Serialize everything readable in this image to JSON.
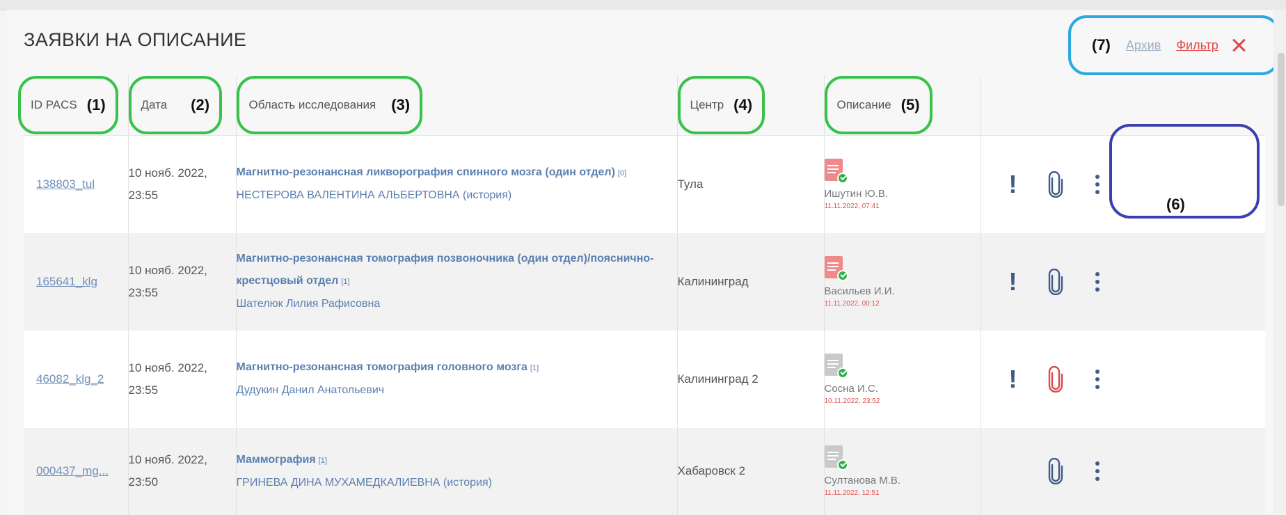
{
  "title": "ЗАЯВКИ НА ОПИСАНИЕ",
  "top_actions": {
    "annotation": "(7)",
    "archive_label": "Архив",
    "filter_label": "Фильтр",
    "close_icon": "close-icon"
  },
  "columns": [
    {
      "label": "ID PACS",
      "annotation": "(1)"
    },
    {
      "label": "Дата",
      "annotation": "(2)"
    },
    {
      "label": "Область исследования",
      "annotation": "(3)"
    },
    {
      "label": "Центр",
      "annotation": "(4)"
    },
    {
      "label": "Описание",
      "annotation": "(5)"
    },
    {
      "label": "",
      "annotation": ""
    }
  ],
  "actions_annotation": "(6)",
  "rows": [
    {
      "id": "138803_tul",
      "date_line1": "10 нояб. 2022,",
      "date_line2": "23:55",
      "study": "Магнитно-резонансная ликворография спинного мозга (один отдел)",
      "study_count": "[0]",
      "study_line2": "",
      "patient": "НЕСТЕРОВА ВАЛЕНТИНА АЛЬБЕРТОВНА (история)",
      "center": "Тула",
      "doc_icon": "red",
      "author": "Ишутин Ю.В.",
      "time": "11.11.2022, 07:41",
      "show_excl": true,
      "clip_color": "#3f5b86"
    },
    {
      "id": "165641_klg",
      "date_line1": "10 нояб. 2022,",
      "date_line2": "23:55",
      "study": "Магнитно-резонансная томография позвоночника (один отдел)/пояснично-",
      "study_count": "[1]",
      "study_line2": "крестцовый отдел",
      "patient": "Шателюк Лилия Рафисовна",
      "center": "Калининград",
      "doc_icon": "red",
      "author": "Васильев И.И.",
      "time": "11.11.2022, 00:12",
      "show_excl": true,
      "clip_color": "#3f5b86"
    },
    {
      "id": "46082_klg_2",
      "date_line1": "10 нояб. 2022,",
      "date_line2": "23:55",
      "study": "Магнитно-резонансная томография головного мозга",
      "study_count": "[1]",
      "study_line2": "",
      "patient": "Дудукин Данил Анатольевич",
      "center": "Калининград 2",
      "doc_icon": "grey",
      "author": "Сосна И.С.",
      "time": "10.11.2022, 23:52",
      "show_excl": true,
      "clip_color": "#d94a4a"
    },
    {
      "id": "000437_mg...",
      "date_line1": "10 нояб. 2022,",
      "date_line2": "23:50",
      "study": "Маммография",
      "study_count": "[1]",
      "study_line2": "",
      "patient": "ГРИНЕВА ДИНА МУХАМЕДКАЛИЕВНА (история)",
      "center": "Хабаровск 2",
      "doc_icon": "grey",
      "author": "Султанова М.В.",
      "time": "11.11.2022, 12:51",
      "show_excl": false,
      "clip_color": "#3f5b86"
    }
  ]
}
